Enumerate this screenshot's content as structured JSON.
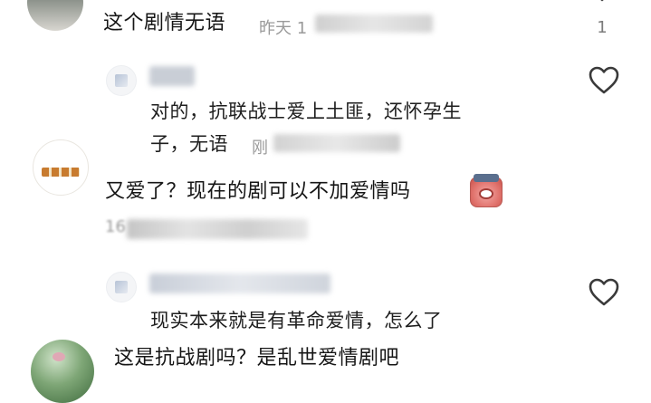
{
  "comments": [
    {
      "text": "这个剧情无语",
      "time": "昨天 1",
      "likes": "1"
    },
    {
      "reply_text_line1": "对的，抗联战士爱上土匪，还怀孕生",
      "reply_text_line2": "子，无语",
      "reply_meta": "刚"
    },
    {
      "text": "又爱了？现在的剧可以不加爱情吗",
      "meta_partial": "16"
    },
    {
      "reply_text": "现实本来就是有革命爱情，怎么了"
    },
    {
      "text": "这是抗战剧吗？是乱世爱情剧吧"
    }
  ],
  "icons": {
    "like": "heart-outline-icon",
    "emoji": "sweat-crying-emoji-icon"
  },
  "colors": {
    "text": "#161616",
    "meta": "#9a9a9a",
    "icon": "#3a3a3a"
  }
}
